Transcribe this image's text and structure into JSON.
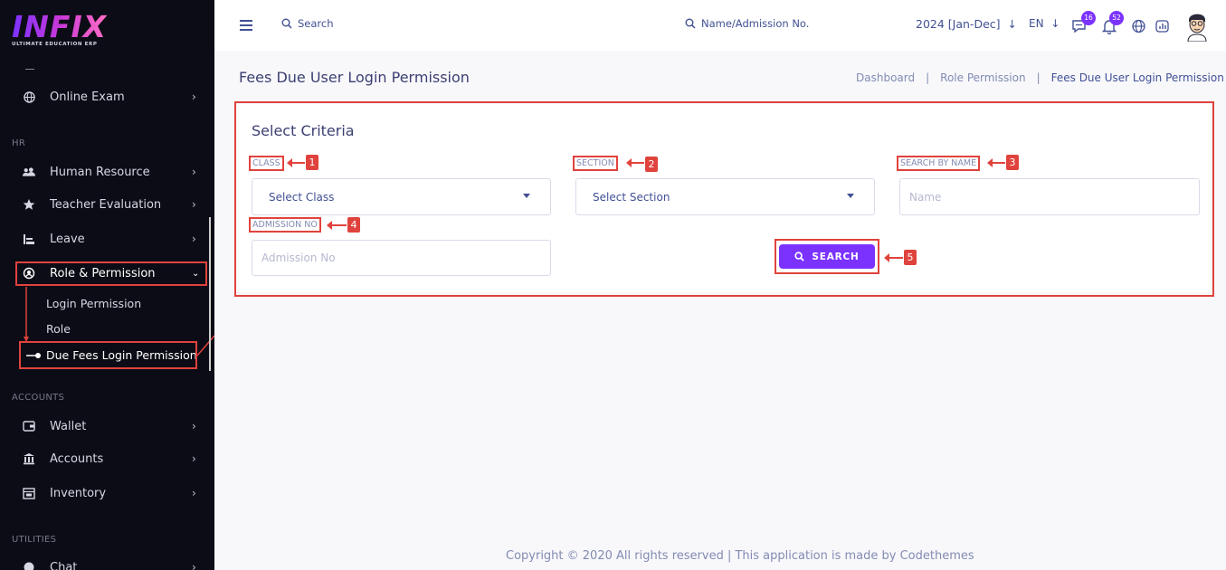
{
  "brand": {
    "name": "INFIX",
    "tagline": "ULTIMATE EDUCATION ERP"
  },
  "sidebar": {
    "items": [
      {
        "label": "Online Exam",
        "icon": "globe-icon"
      },
      {
        "label": "Human Resource",
        "icon": "users-icon"
      },
      {
        "label": "Teacher Evaluation",
        "icon": "star-icon"
      },
      {
        "label": "Leave",
        "icon": "leave-icon"
      },
      {
        "label": "Role & Permission",
        "icon": "role-permission-icon"
      },
      {
        "label": "Wallet",
        "icon": "wallet-icon"
      },
      {
        "label": "Accounts",
        "icon": "bank-icon"
      },
      {
        "label": "Inventory",
        "icon": "inventory-icon"
      },
      {
        "label": "Chat",
        "icon": "chat-icon"
      }
    ],
    "sections": {
      "hr": "HR",
      "accounts": "ACCOUNTS",
      "utilities": "UTILITIES"
    },
    "sub_items": [
      "Login Permission",
      "Role",
      "Due Fees Login Permission"
    ]
  },
  "header": {
    "search_label": "Search",
    "admission_label": "Name/Admission No.",
    "year": "2024 [Jan-Dec]",
    "lang": "EN",
    "messages_count": "16",
    "notifications_count": "52"
  },
  "page": {
    "title": "Fees Due User Login Permission",
    "breadcrumb": [
      "Dashboard",
      "Role Permission",
      "Fees Due User Login Permission"
    ]
  },
  "criteria": {
    "title": "Select Criteria",
    "class_label": "CLASS",
    "class_value": "Select Class",
    "section_label": "SECTION",
    "section_value": "Select Section",
    "name_label": "SEARCH BY NAME",
    "name_placeholder": "Name",
    "admission_label": "ADMISSION NO",
    "admission_placeholder": "Admission No",
    "search_button": "SEARCH"
  },
  "markers": [
    "1",
    "2",
    "3",
    "4",
    "5"
  ],
  "footer": "Copyright © 2020 All rights reserved | This application is made by Codethemes",
  "colors": {
    "accent": "#7c32ff",
    "annotation": "#e0433d",
    "sidebar_bg": "#0c0c16",
    "text": "#415094"
  }
}
